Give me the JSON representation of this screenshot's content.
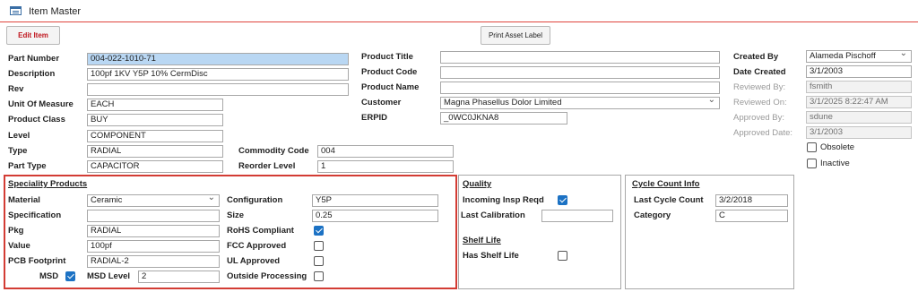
{
  "window": {
    "title": "Item Master"
  },
  "buttons": {
    "edit": "Edit Item",
    "print": "Print Asset Label"
  },
  "left": {
    "part_number_label": "Part Number",
    "part_number": "004-022-1010-71",
    "description_label": "Description",
    "description": "100pf 1KV Y5P 10% CermDisc",
    "rev_label": "Rev",
    "rev": "",
    "uom_label": "Unit Of Measure",
    "uom": "EACH",
    "product_class_label": "Product Class",
    "product_class": "BUY",
    "level_label": "Level",
    "level": "COMPONENT",
    "type_label": "Type",
    "type": "RADIAL",
    "part_type_label": "Part Type",
    "part_type": "CAPACITOR",
    "commodity_code_label": "Commodity Code",
    "commodity_code": "004",
    "reorder_level_label": "Reorder Level",
    "reorder_level": "1"
  },
  "product": {
    "title_label": "Product Title",
    "title": "",
    "code_label": "Product Code",
    "code": "",
    "name_label": "Product Name",
    "name": "",
    "customer_label": "Customer",
    "customer": "Magna Phasellus Dolor Limited",
    "erpid_label": "ERPID",
    "erpid": "_0WC0JKNA8"
  },
  "audit": {
    "created_by_label": "Created By",
    "created_by": "Alameda Pischoff",
    "date_created_label": "Date Created",
    "date_created": "3/1/2003",
    "reviewed_by_label": "Reviewed By:",
    "reviewed_by": "fsmith",
    "reviewed_on_label": "Reviewed On:",
    "reviewed_on": "3/1/2025 8:22:47 AM",
    "approved_by_label": "Approved By:",
    "approved_by": "sdune",
    "approved_date_label": "Approved Date:",
    "approved_date": "3/1/2003",
    "obsolete_label": "Obsolete",
    "obsolete": false,
    "inactive_label": "Inactive",
    "inactive": false
  },
  "speciality": {
    "heading": "Speciality Products",
    "material_label": "Material",
    "material": "Ceramic",
    "specification_label": "Specification",
    "specification": "",
    "pkg_label": "Pkg",
    "pkg": "RADIAL",
    "value_label": "Value",
    "value": "100pf",
    "pcb_footprint_label": "PCB Footprint",
    "pcb_footprint": "RADIAL-2",
    "msd_label": "MSD",
    "msd": true,
    "msd_level_label": "MSD Level",
    "msd_level": "2",
    "configuration_label": "Configuration",
    "configuration": "Y5P",
    "size_label": "Size",
    "size": "0.25",
    "rohs_label": "RoHS Compliant",
    "rohs": true,
    "fcc_label": "FCC Approved",
    "fcc": false,
    "ul_label": "UL Approved",
    "ul": false,
    "outside_label": "Outside Processing",
    "outside": false
  },
  "quality": {
    "heading": "Quality",
    "incoming_label": "Incoming Insp Reqd",
    "incoming": true,
    "last_cal_label": "Last Calibration",
    "last_cal": "",
    "shelf_heading": "Shelf Life",
    "has_shelf_label": "Has Shelf Life",
    "has_shelf": false
  },
  "cycle": {
    "heading": "Cycle Count Info",
    "last_label": "Last Cycle Count",
    "last": "3/2/2018",
    "category_label": "Category",
    "category": "C"
  }
}
